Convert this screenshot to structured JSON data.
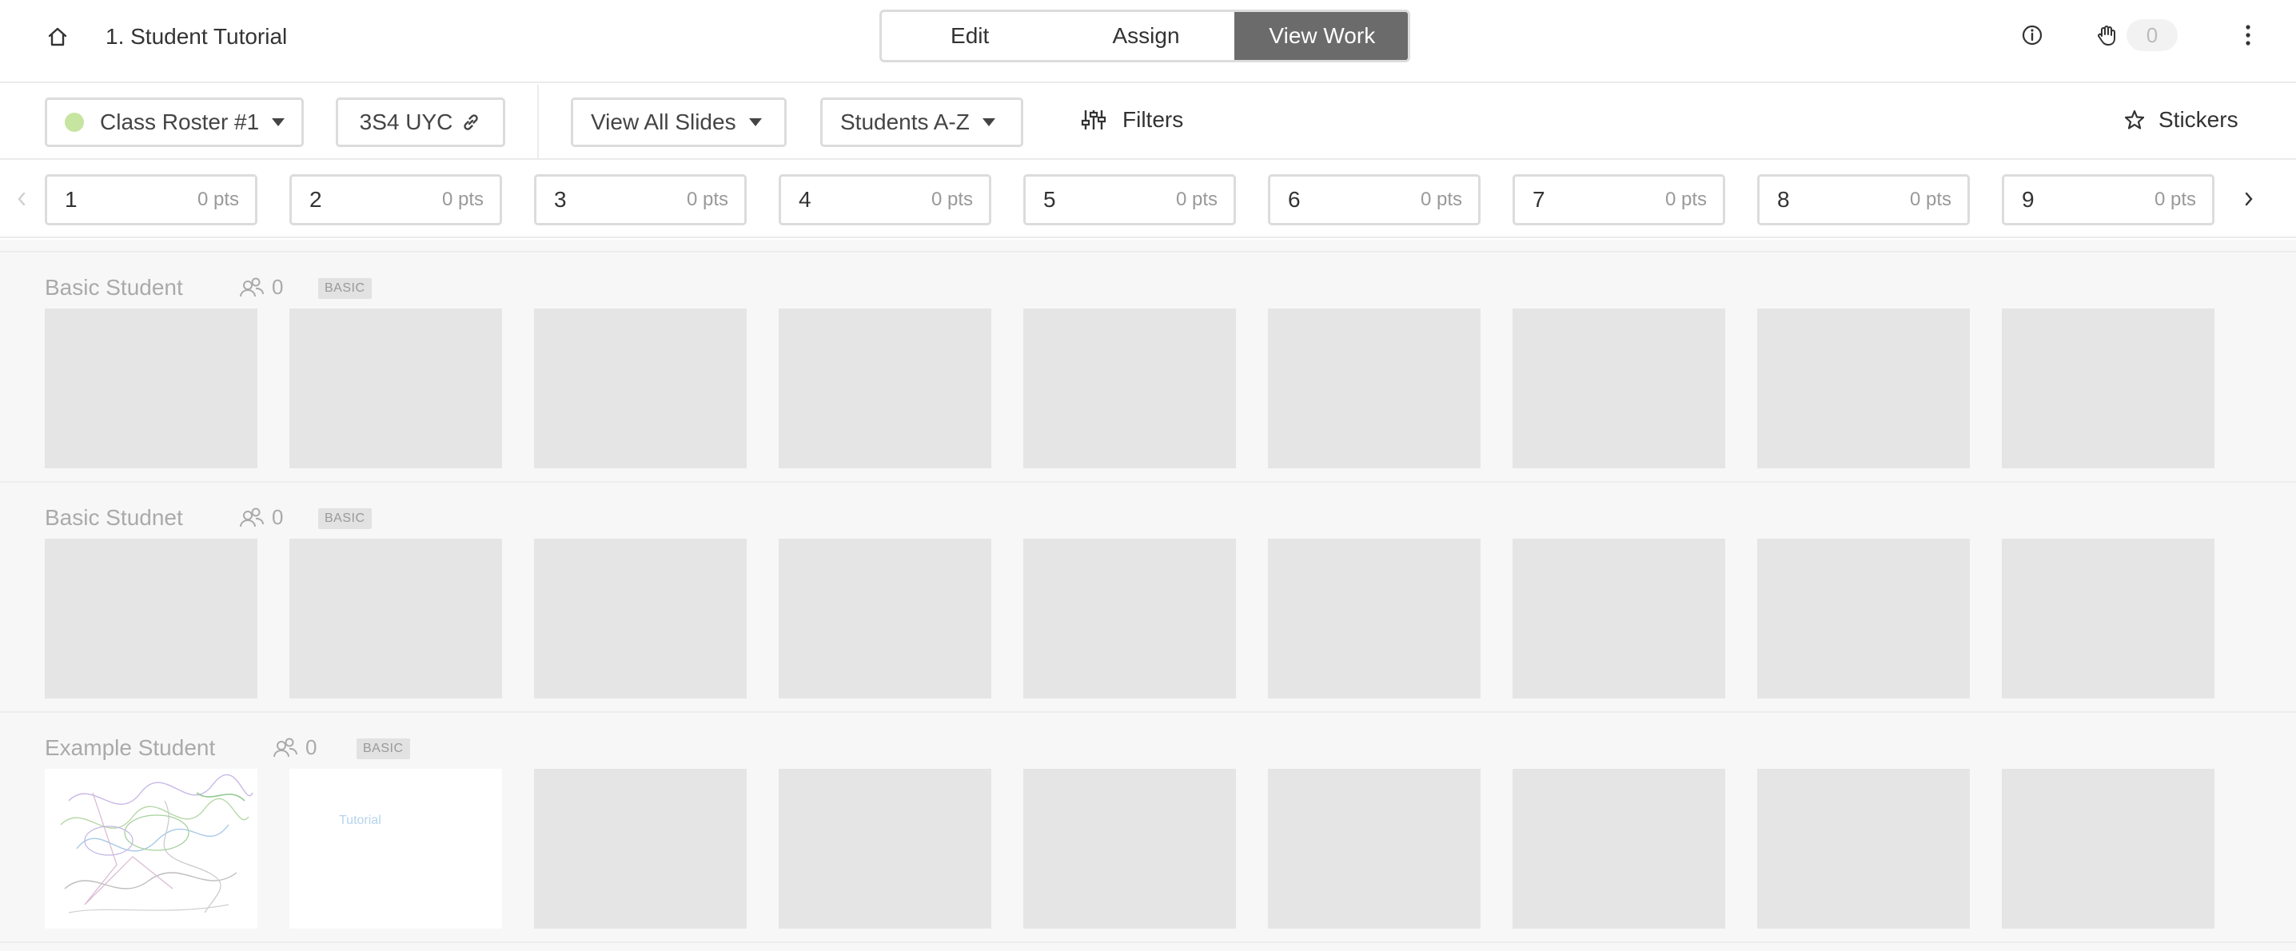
{
  "header": {
    "title": "1. Student Tutorial",
    "modes": [
      "Edit",
      "Assign",
      "View Work"
    ],
    "active_mode": "View Work",
    "hand_count": "0"
  },
  "toolbar": {
    "roster_label": "Class Roster #1",
    "roster_color": "#c5e5a0",
    "class_code": "3S4 UYC",
    "slides_filter": "View All Slides",
    "sort": "Students A-Z",
    "filters_label": "Filters",
    "stickers_label": "Stickers"
  },
  "slides": [
    {
      "number": "1",
      "points": "0 pts"
    },
    {
      "number": "2",
      "points": "0 pts"
    },
    {
      "number": "3",
      "points": "0 pts"
    },
    {
      "number": "4",
      "points": "0 pts"
    },
    {
      "number": "5",
      "points": "0 pts"
    },
    {
      "number": "6",
      "points": "0 pts"
    },
    {
      "number": "7",
      "points": "0 pts"
    },
    {
      "number": "8",
      "points": "0 pts"
    },
    {
      "number": "9",
      "points": "0 pts"
    }
  ],
  "students": [
    {
      "name": "Basic Student",
      "count": "0",
      "level": "BASIC"
    },
    {
      "name": "Basic Studnet",
      "count": "0",
      "level": "BASIC"
    },
    {
      "name": "Example Student",
      "count": "0",
      "level": "BASIC",
      "thumb_text": "Tutorial"
    }
  ]
}
